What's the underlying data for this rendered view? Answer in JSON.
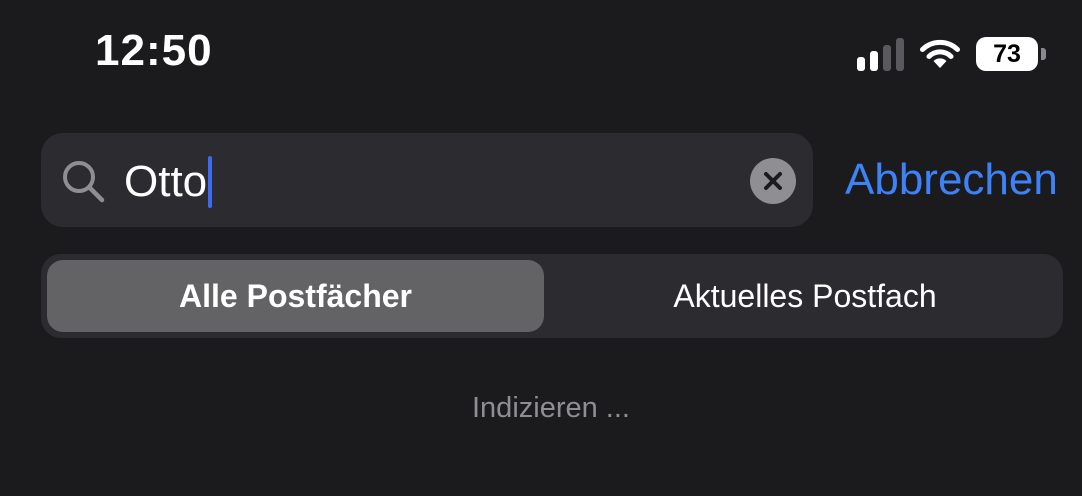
{
  "status_bar": {
    "time": "12:50",
    "battery_level": "73",
    "signal_bars_active": 2,
    "signal_bars_total": 4,
    "icons": [
      "signal-icon",
      "wifi-icon",
      "battery-icon"
    ]
  },
  "search": {
    "value": "Otto",
    "icon": "search-icon",
    "clear_icon": "close-icon",
    "cancel_label": "Abbrechen"
  },
  "scope": {
    "options": [
      "Alle Postfächer",
      "Aktuelles Postfach"
    ],
    "selected": "Alle Postfächer"
  },
  "status_message": "Indizieren ...",
  "colors": {
    "background": "#1b1b1d",
    "field": "#2c2c30",
    "selected_segment": "#636366",
    "accent": "#3d82f6",
    "caret": "#3d6bf0",
    "secondary_text": "#8e8e93"
  }
}
